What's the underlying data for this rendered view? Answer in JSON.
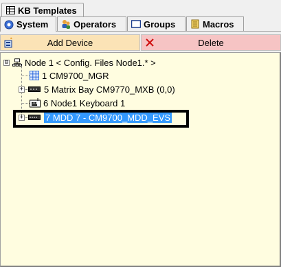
{
  "window": {
    "title_tab": "KB Templates"
  },
  "tabs": [
    {
      "label": "System",
      "icon": "system-icon",
      "active": true
    },
    {
      "label": "Operators",
      "icon": "operators-icon",
      "active": false
    },
    {
      "label": "Groups",
      "icon": "groups-icon",
      "active": false
    },
    {
      "label": "Macros",
      "icon": "macros-icon",
      "active": false
    }
  ],
  "toolbar": {
    "add_label": "Add Device",
    "delete_label": "Delete"
  },
  "tree": {
    "root": {
      "label": "Node 1 < Config. Files Node1.* >",
      "expander": "⊟"
    },
    "children": [
      {
        "label": "1 CM9700_MGR",
        "icon": "manager-grid-icon"
      },
      {
        "label": "5 Matrix Bay CM9770_MXB (0,0)",
        "icon": "matrix-bay-icon",
        "expander": "+"
      },
      {
        "label": "6 Node1 Keyboard 1",
        "icon": "keyboard-icon"
      },
      {
        "label": "7 MDD 7 - CM9700_MDD_EVS",
        "icon": "mdd-device-icon",
        "expander": "+",
        "selected": true
      }
    ]
  },
  "colors": {
    "add_bg": "#fbe3b6",
    "delete_bg": "#f6c4c4",
    "tree_bg": "#fffde0",
    "selection": "#3399ff"
  }
}
